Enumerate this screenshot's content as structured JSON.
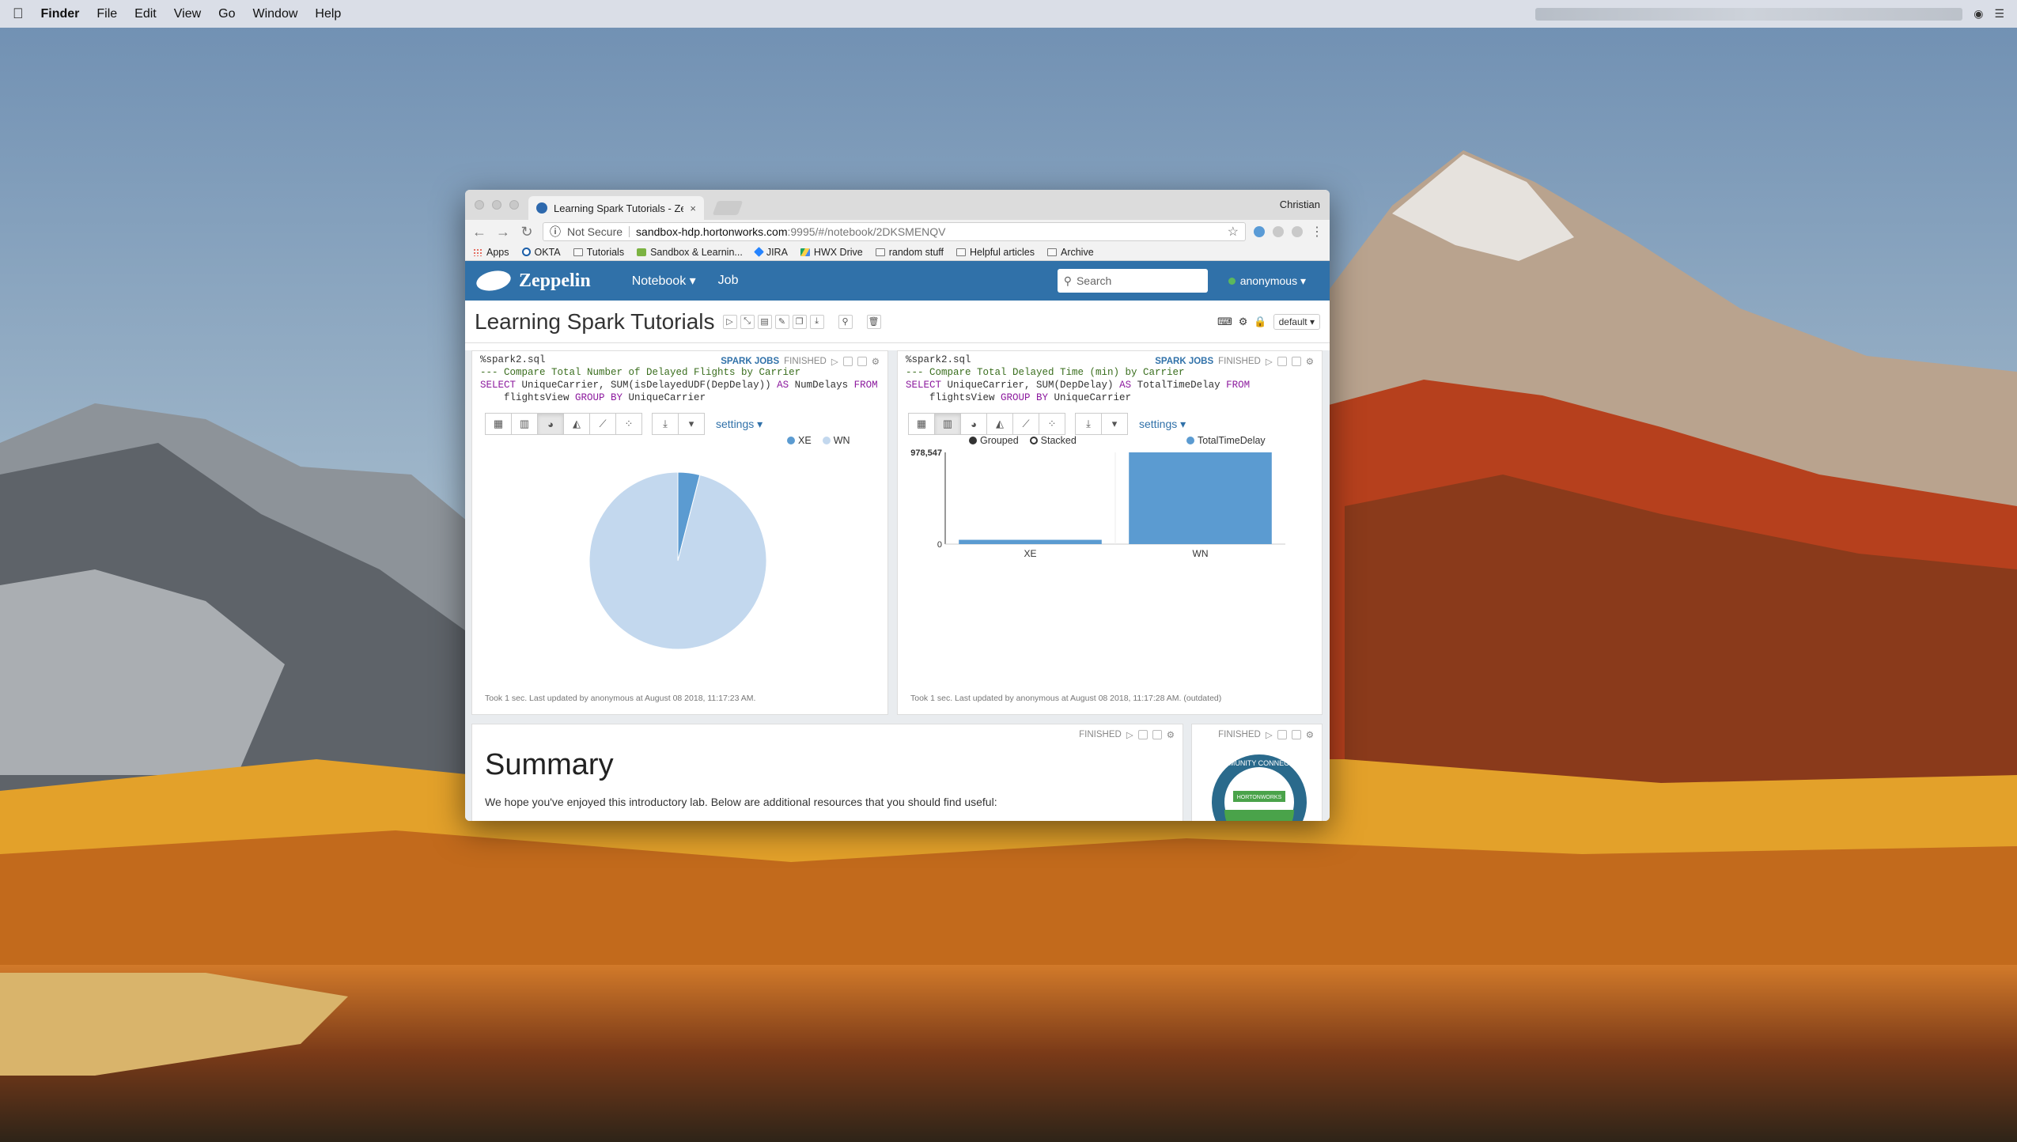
{
  "menubar": {
    "app": "Finder",
    "items": [
      "File",
      "Edit",
      "View",
      "Go",
      "Window",
      "Help"
    ]
  },
  "browser": {
    "tab_title": "Learning Spark Tutorials - Zep",
    "tab_close": "×",
    "profile": "Christian",
    "address": {
      "security": "Not Secure",
      "host": "sandbox-hdp.hortonworks.com",
      "path": ":9995/#/notebook/2DKSMENQV"
    },
    "bookmarks": [
      {
        "label": "Apps",
        "icon": "apps-icon"
      },
      {
        "label": "OKTA",
        "icon": "okta-icon"
      },
      {
        "label": "Tutorials",
        "icon": "folder-icon"
      },
      {
        "label": "Sandbox & Learnin...",
        "icon": "leaf-icon"
      },
      {
        "label": "JIRA",
        "icon": "jira-icon"
      },
      {
        "label": "HWX Drive",
        "icon": "drive-icon"
      },
      {
        "label": "random stuff",
        "icon": "folder-icon"
      },
      {
        "label": "Helpful articles",
        "icon": "folder-icon"
      },
      {
        "label": "Archive",
        "icon": "folder-icon"
      }
    ]
  },
  "zeppelin": {
    "brand": "Zeppelin",
    "nav": {
      "notebook": "Notebook ▾",
      "job": "Job"
    },
    "search_placeholder": "Search",
    "user": "anonymous ▾",
    "notebook_title": "Learning Spark Tutorials",
    "interpreter": "default ▾"
  },
  "paragraphs": {
    "left": {
      "line1": "%spark2.sql",
      "line2": "--- Compare Total Number of Delayed Flights by Carrier",
      "line3_a": "SELECT",
      "line3_b": " UniqueCarrier, SUM(isDelayedUDF(DepDelay)) ",
      "line3_c": "AS",
      "line3_d": " NumDelays ",
      "line3_e": "FROM",
      "line4_a": "    flightsView ",
      "line4_b": "GROUP BY",
      "line4_c": " UniqueCarrier",
      "spark_jobs": "SPARK JOBS",
      "status": "FINISHED",
      "settings": "settings ▾",
      "footer": "Took 1 sec. Last updated by anonymous at August 08 2018, 11:17:23 AM."
    },
    "right": {
      "line1": "%spark2.sql",
      "line2": "--- Compare Total Delayed Time (min) by Carrier",
      "line3_a": "SELECT",
      "line3_b": " UniqueCarrier, SUM(DepDelay) ",
      "line3_c": "AS",
      "line3_d": " TotalTimeDelay ",
      "line3_e": "FROM",
      "line4_a": "    flightsView ",
      "line4_b": "GROUP BY",
      "line4_c": " UniqueCarrier",
      "spark_jobs": "SPARK JOBS",
      "status": "FINISHED",
      "settings": "settings ▾",
      "grouped": "Grouped",
      "stacked": "Stacked",
      "footer": "Took 1 sec. Last updated by anonymous at August 08 2018, 11:17:28 AM. (outdated)"
    },
    "summary": {
      "status": "FINISHED",
      "title": "Summary",
      "text": "We hope you've enjoyed this introductory lab. Below are additional resources that you should find useful:"
    },
    "badge": {
      "status": "FINISHED",
      "ring_text": "COMMUNITY CONNECTION",
      "brand": "HORTONWORKS"
    }
  },
  "chart_data": [
    {
      "type": "pie",
      "categories": [
        "XE",
        "WN"
      ],
      "values": [
        4,
        96
      ],
      "legend": [
        "XE",
        "WN"
      ],
      "legend_placement": "top-right",
      "colors": [
        "#5b9bd1",
        "#c3d8ee"
      ]
    },
    {
      "type": "bar",
      "categories": [
        "XE",
        "WN"
      ],
      "series": [
        {
          "name": "TotalTimeDelay",
          "values": [
            46000,
            978547
          ]
        }
      ],
      "ylim": [
        0,
        978547
      ],
      "yticks": [
        "0",
        "978,547"
      ],
      "legend_placement": "top-right",
      "colors": [
        "#5b9bd1"
      ]
    }
  ],
  "colors": {
    "zeppelin_nav": "#3071a9",
    "bar": "#5b9bd1",
    "pie_light": "#c3d8ee"
  }
}
